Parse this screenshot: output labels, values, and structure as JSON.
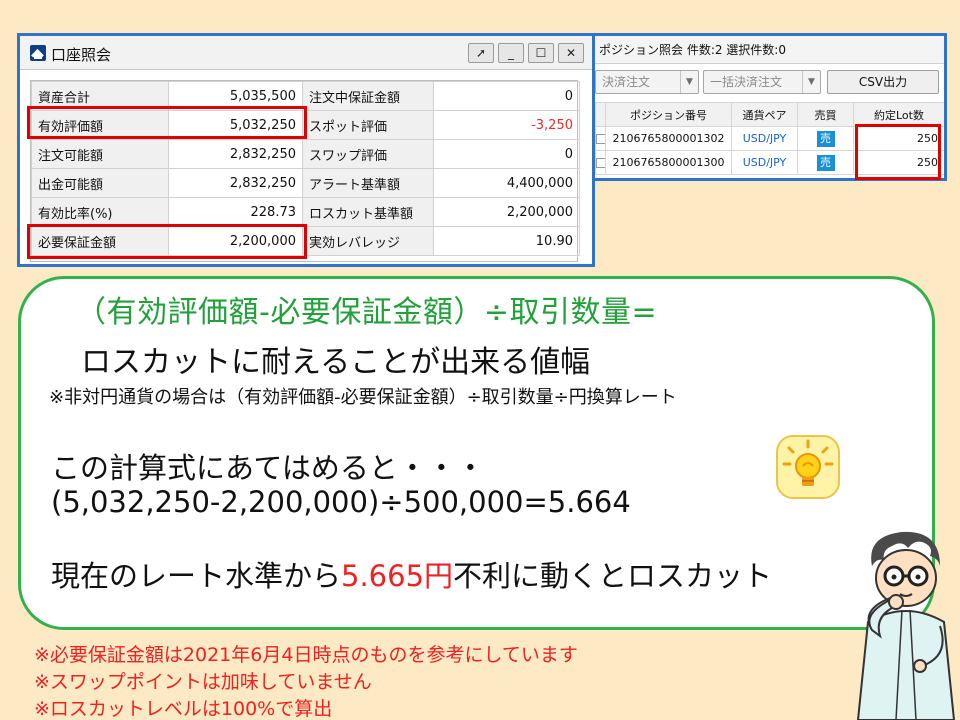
{
  "account_window": {
    "title": "口座照会",
    "buttons": {
      "pin": "➚",
      "minimize": "_",
      "maximize": "☐",
      "close": "✕"
    },
    "rows": [
      {
        "left_label": "資産合計",
        "left_value": "5,035,500",
        "right_label": "注文中保証金額",
        "right_value": "0"
      },
      {
        "left_label": "有効評価額",
        "left_value": "5,032,250",
        "right_label": "スポット評価",
        "right_value": "-3,250"
      },
      {
        "left_label": "注文可能額",
        "left_value": "2,832,250",
        "right_label": "スワップ評価",
        "right_value": "0"
      },
      {
        "left_label": "出金可能額",
        "left_value": "2,832,250",
        "right_label": "アラート基準額",
        "right_value": "4,400,000"
      },
      {
        "left_label": "有効比率(%)",
        "left_value": "228.73",
        "right_label": "ロスカット基準額",
        "right_value": "2,200,000"
      },
      {
        "left_label": "必要保証金額",
        "left_value": "2,200,000",
        "right_label": "実効レバレッジ",
        "right_value": "10.90"
      }
    ]
  },
  "position_window": {
    "title": "ポジション照会 件数:2 選択件数:0",
    "toolbar": {
      "settle_order": "決済注文",
      "bulk_settle_order": "一括決済注文",
      "csv_output": "CSV出力"
    },
    "columns": [
      "ポジション番号",
      "通貨ペア",
      "売買",
      "約定Lot数"
    ],
    "rows": [
      {
        "id": "2106765800001302",
        "pair": "USD/JPY",
        "side": "売",
        "lots": "250"
      },
      {
        "id": "2106765800001300",
        "pair": "USD/JPY",
        "side": "売",
        "lots": "250"
      }
    ]
  },
  "explanation": {
    "formula_title": "（有効評価額-必要保証金額）÷取引数量=",
    "formula_subtitle": "ロスカットに耐えることが出来る値幅",
    "note": "※非対円通貨の場合は（有効評価額-必要保証金額）÷取引数量÷円換算レート",
    "calc_intro": "この計算式にあてはめると・・・",
    "calc_expression": "(5,032,250-2,200,000)÷500,000=5.664",
    "result_prefix": "現在のレート水準から",
    "result_highlight": "5.665円",
    "result_suffix": "不利に動くとロスカット"
  },
  "footnotes": [
    "※必要保証金額は2021年6月4日時点のものを参考にしています",
    "※スワップポイントは加味していません",
    "※ロスカットレベルは100%で算出"
  ],
  "colors": {
    "window_border": "#2e74c8",
    "highlight_box": "#e00000",
    "formula_green": "#22a03a",
    "note_red": "#ee2222",
    "background": "#fde9c4"
  }
}
